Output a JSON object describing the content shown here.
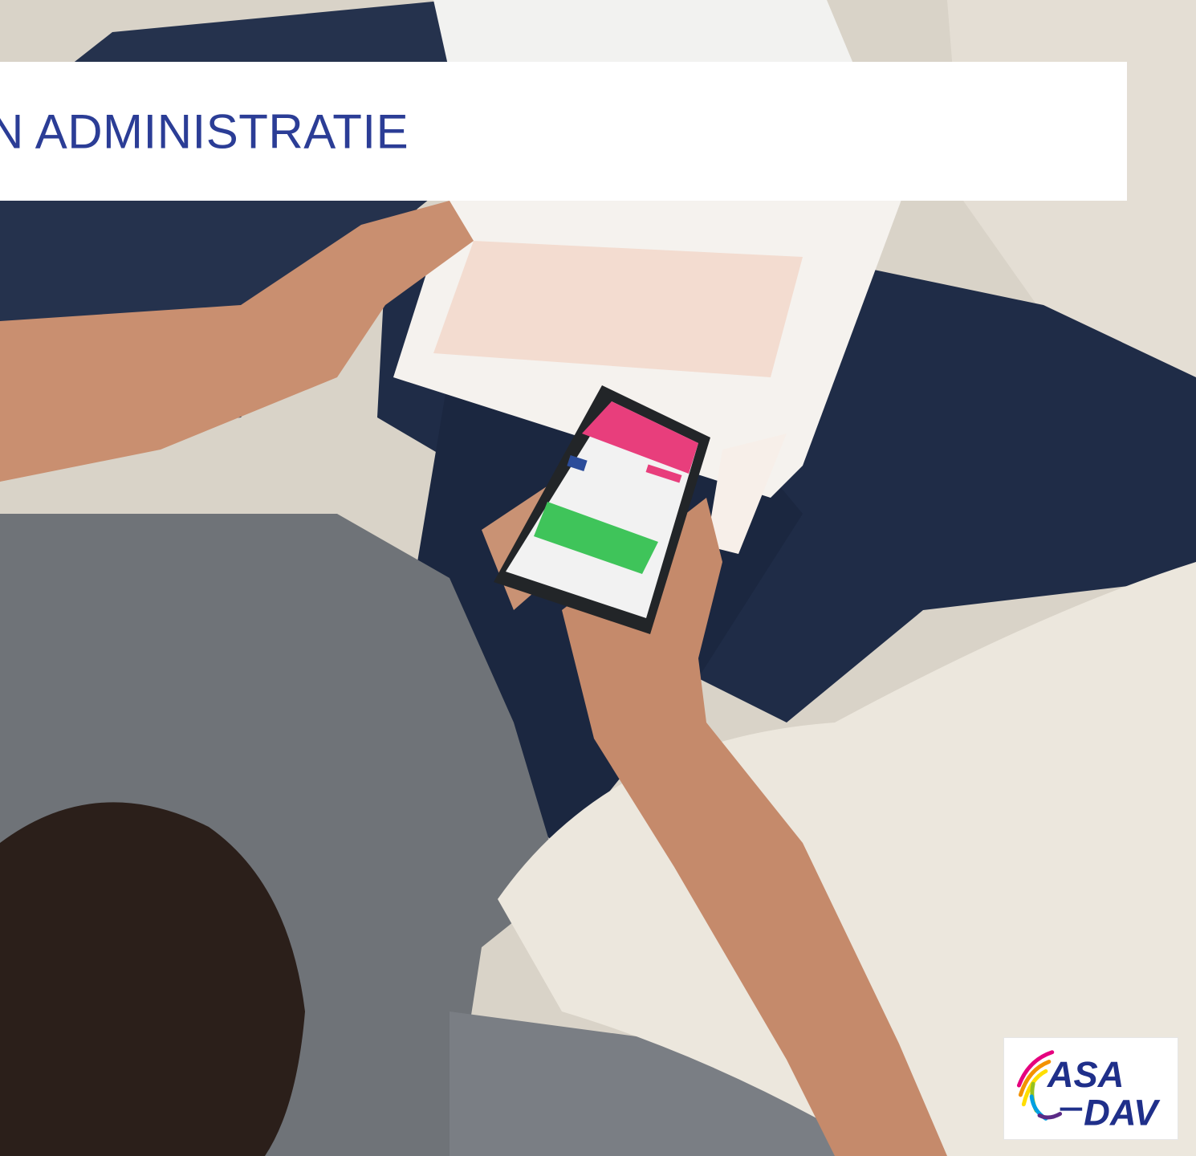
{
  "header": {
    "title": "N ADMINISTRATIE"
  },
  "logo": {
    "line1": "ASA",
    "line2": "DAV",
    "text_color": "#1f2f8a",
    "swoosh_colors": [
      "#e5007e",
      "#f39200",
      "#ffde00",
      "#95c11f",
      "#00a0e3",
      "#5b2a86"
    ]
  },
  "photo": {
    "description_icon": "person-on-couch-with-phone-photo"
  },
  "colors": {
    "title": "#2b3d96",
    "band": "#ffffff",
    "phone_header": "#e83e7c",
    "phone_button": "#3fc45a"
  }
}
